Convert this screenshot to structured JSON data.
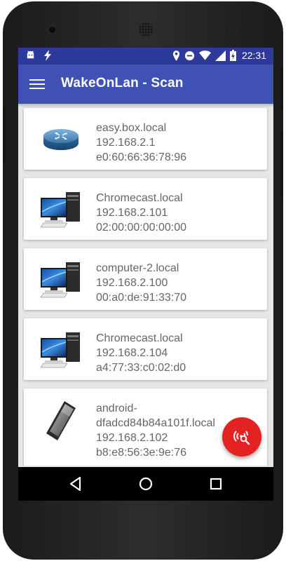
{
  "status_bar": {
    "time": "22:31",
    "icons": [
      "android-icon",
      "flash-icon",
      "location-icon",
      "do-not-disturb-icon",
      "wifi-icon",
      "signal-icon",
      "battery-icon"
    ]
  },
  "app_bar": {
    "title": "WakeOnLan - Scan",
    "menu_icon": "hamburger-menu-icon"
  },
  "devices": [
    {
      "icon": "router-icon",
      "hostname": "easy.box.local",
      "ip": "192.168.2.1",
      "mac": "e0:60:66:36:78:96"
    },
    {
      "icon": "desktop-computer-icon",
      "hostname": "Chromecast.local",
      "ip": "192.168.2.101",
      "mac": "02:00:00:00:00:00"
    },
    {
      "icon": "desktop-computer-icon",
      "hostname": "computer-2.local",
      "ip": "192.168.2.100",
      "mac": "00:a0:de:91:33:70"
    },
    {
      "icon": "desktop-computer-icon",
      "hostname": "Chromecast.local",
      "ip": "192.168.2.104",
      "mac": "a4:77:33:c0:02:d0"
    },
    {
      "icon": "smartphone-icon",
      "hostname_line1": "android-",
      "hostname_line2": "dfadcd84b84a101f.local",
      "ip": "192.168.2.102",
      "mac": "b8:e8:56:3e:9e:76"
    }
  ],
  "fab": {
    "icon": "network-search-icon",
    "color": "#e52222"
  },
  "colors": {
    "primary": "#3f51b5",
    "primary_dark": "#2e3a9a",
    "accent": "#e52222"
  },
  "nav_bar": {
    "icons": [
      "back-icon",
      "home-icon",
      "recents-icon"
    ]
  }
}
